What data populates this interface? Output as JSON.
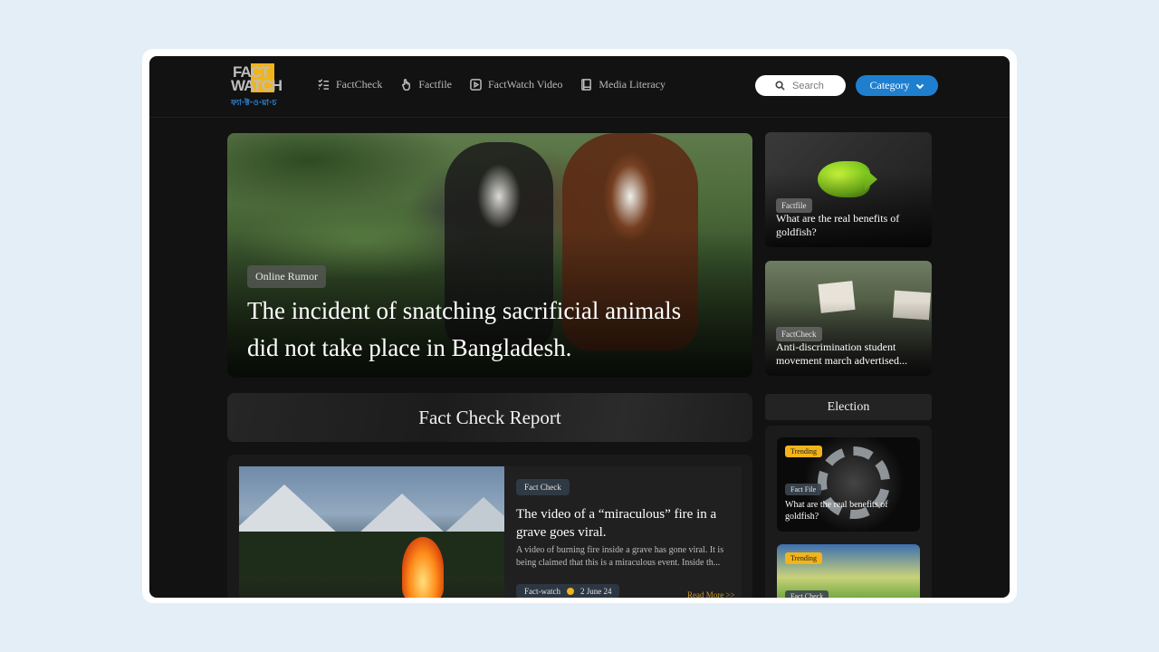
{
  "logo": {
    "line1": "FACT",
    "line2": "WATCH",
    "bengali": "ফ্যা·ক্ট·ও·য়া·চ"
  },
  "nav": [
    {
      "label": "FactCheck",
      "icon": "checklist-icon"
    },
    {
      "label": "Factfile",
      "icon": "pointer-hand-icon"
    },
    {
      "label": "FactWatch Video",
      "icon": "play-icon"
    },
    {
      "label": "Media Literacy",
      "icon": "book-icon"
    }
  ],
  "search": {
    "placeholder": "Search"
  },
  "category": {
    "label": "Category"
  },
  "hero": {
    "badge": "Online Rumor",
    "title": "The incident of snatching sacrificial animals did not take place in Bangladesh."
  },
  "side_cards": [
    {
      "tag": "Factfile",
      "caption": "What are the real benefits of goldfish?"
    },
    {
      "tag": "FactCheck",
      "caption": "Anti-discrimination student movement march advertised..."
    }
  ],
  "banner": {
    "title": "Fact Check Report"
  },
  "article": {
    "tag": "Fact Check",
    "title": "The video of a “miraculous” fire in a grave goes viral.",
    "description": "A video of burning fire inside a grave has gone viral. It is being claimed that this is a miraculous event. Inside th...",
    "source": "Fact-watch",
    "date": "2 June 24",
    "read_more": "Read More >>"
  },
  "election": {
    "heading": "Election",
    "cards": [
      {
        "badge": "Trending",
        "tag": "Fact File",
        "caption": "What are the real benefits of goldfish?"
      },
      {
        "badge": "Trending",
        "tag": "Fact Check",
        "caption": ""
      }
    ]
  },
  "colors": {
    "accent": "#1f7fcf",
    "highlight": "#f2b418",
    "background": "#121212"
  }
}
